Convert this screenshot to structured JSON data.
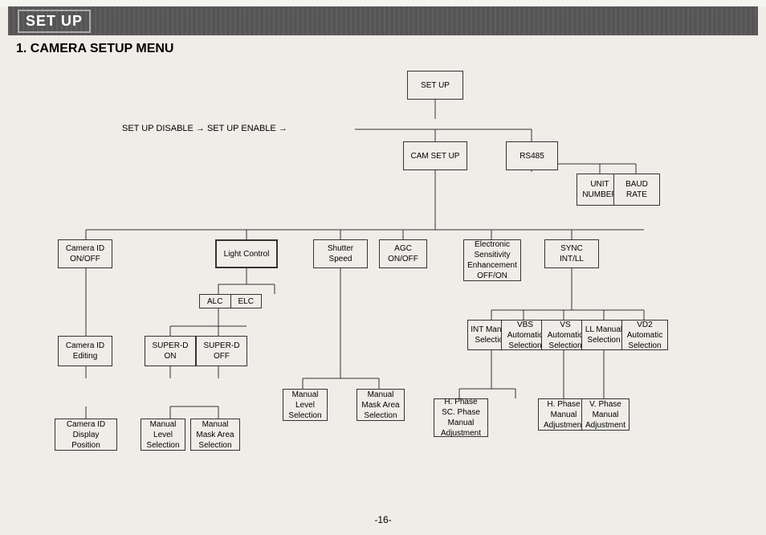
{
  "header": {
    "title": "SET UP"
  },
  "section": {
    "label": "1. CAMERA SETUP MENU"
  },
  "boxes": {
    "setup": "SET UP",
    "cam_setup": "CAM SET UP",
    "rs485": "RS485",
    "unit_number": "UNIT\nNUMBER",
    "baud_rate": "BAUD\nRATE",
    "camera_id_onoff": "Camera\nID\nON/OFF",
    "light_control": "Light\nControl",
    "alc": "ALC",
    "elc": "ELC",
    "shutter_speed": "Shutter\nSpeed",
    "agc_onoff": "AGC\nON/OFF",
    "ese_offon": "Electronic\nSensitivity\nEnhancement\nOFF/ON",
    "sync_intll": "SYNC\nINT/LL",
    "camera_id_editing": "Camera\nID\nEditing",
    "super_d_on": "SUPER-D\nON",
    "super_d_off": "SUPER-D\nOFF",
    "int_manual": "INT\nManual\nSelection",
    "vbs_automatic": "VBS\nAutomatic\nSelection",
    "vs_automatic": "VS\nAutomatic\nSelection",
    "ll_manual": "LL\nManual\nSelection",
    "vd2_automatic": "VD2\nAutomatic\nSelection",
    "camera_id_display": "Camera ID\nDisplay\nPosition",
    "manual_level_sel1": "Manual\nLevel\nSelection",
    "manual_mask_area1": "Manual\nMask Area\nSelection",
    "manual_level_sel2": "Manual\nLevel\nSelection",
    "manual_mask_area2": "Manual\nMask Area\nSelection",
    "h_phase_sc": "H. Phase\nSC. Phase\nManual\nAdjustment",
    "h_phase_manual": "H. Phase\nManual\nAdjustment",
    "v_phase_manual": "V. Phase\nManual\nAdjustment"
  },
  "labels": {
    "setup_flow": "SET UP DISABLE → SET UP ENABLE →",
    "page_number": "-16-"
  }
}
